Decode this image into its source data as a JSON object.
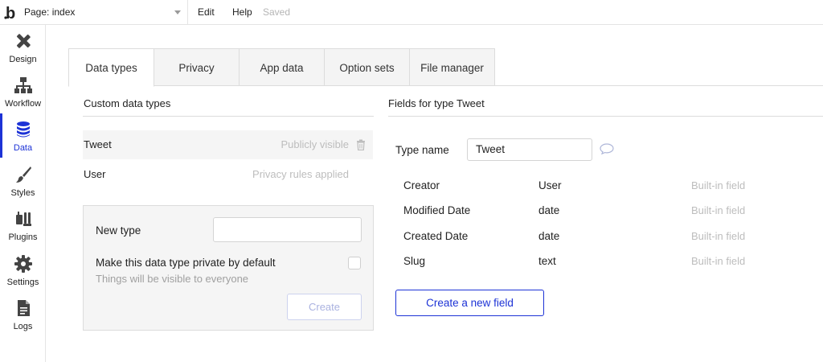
{
  "topbar": {
    "logo_text": "b",
    "page_selector": "Page: index",
    "menu_edit": "Edit",
    "menu_help": "Help",
    "save_status": "Saved"
  },
  "sidebar": {
    "items": [
      {
        "label": "Design",
        "icon": "design-icon"
      },
      {
        "label": "Workflow",
        "icon": "workflow-icon"
      },
      {
        "label": "Data",
        "icon": "data-icon",
        "active": true
      },
      {
        "label": "Styles",
        "icon": "brush-icon"
      },
      {
        "label": "Plugins",
        "icon": "plugin-icon"
      },
      {
        "label": "Settings",
        "icon": "gear-icon"
      },
      {
        "label": "Logs",
        "icon": "document-icon"
      }
    ]
  },
  "tabs": [
    {
      "label": "Data types",
      "active": true
    },
    {
      "label": "Privacy"
    },
    {
      "label": "App data"
    },
    {
      "label": "Option sets"
    },
    {
      "label": "File manager"
    }
  ],
  "custom_types": {
    "title": "Custom data types",
    "items": [
      {
        "name": "Tweet",
        "status": "Publicly visible",
        "selected": true
      },
      {
        "name": "User",
        "status": "Privacy rules applied"
      }
    ],
    "new_type_label": "New type",
    "new_type_value": "",
    "private_label": "Make this data type private by default",
    "private_hint": "Things will be visible to everyone",
    "create_label": "Create"
  },
  "fields": {
    "title": "Fields for type Tweet",
    "type_name_label": "Type name",
    "type_name_value": "Tweet",
    "rows": [
      {
        "name": "Creator",
        "type": "User",
        "note": "Built-in field"
      },
      {
        "name": "Modified Date",
        "type": "date",
        "note": "Built-in field"
      },
      {
        "name": "Created Date",
        "type": "date",
        "note": "Built-in field"
      },
      {
        "name": "Slug",
        "type": "text",
        "note": "Built-in field"
      }
    ],
    "create_field_label": "Create a new field"
  },
  "colors": {
    "accent": "#1d33d6",
    "muted_text": "#bdbdbd",
    "panel_bg": "#f5f5f5"
  }
}
